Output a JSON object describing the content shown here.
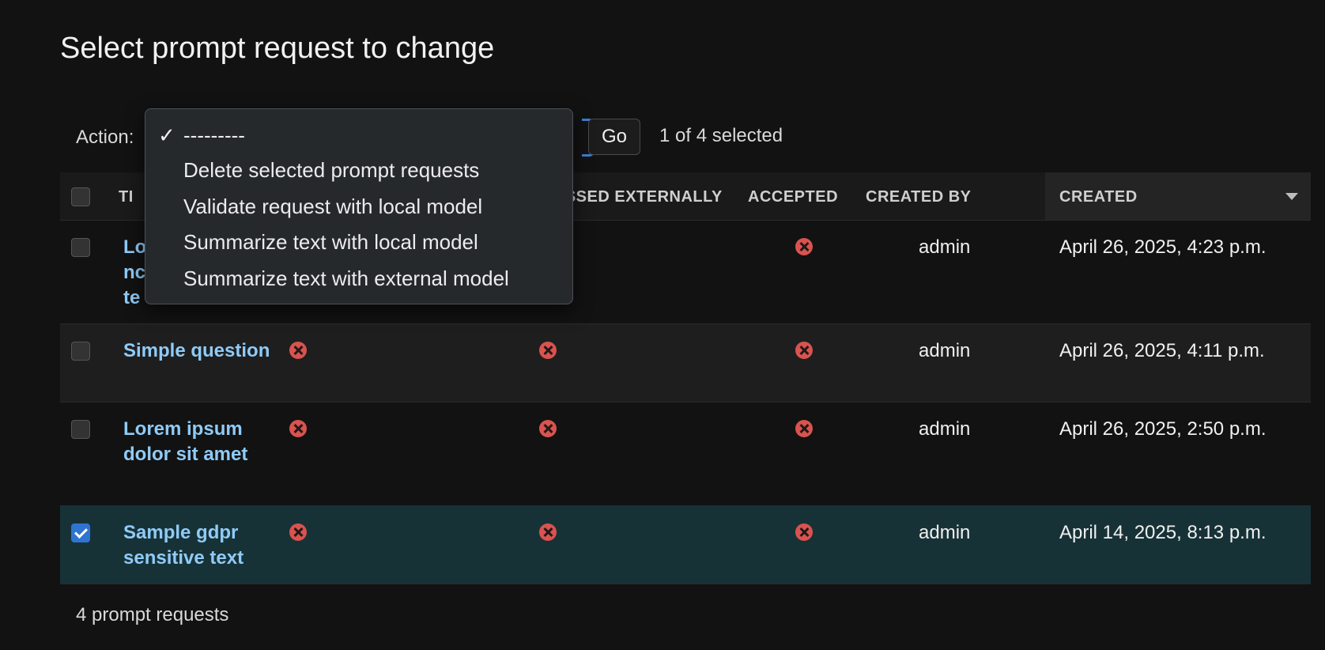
{
  "page": {
    "title": "Select prompt request to change"
  },
  "actions": {
    "label": "Action:",
    "options": [
      "---------",
      "Delete selected prompt requests",
      "Validate request with local model",
      "Summarize text with local model",
      "Summarize text with external model"
    ],
    "selected_index": 0,
    "go_label": "Go",
    "selection_status": "1 of 4 selected"
  },
  "table": {
    "headers": [
      "TI",
      "OCESSED EXTERNALLY",
      "ACCEPTED",
      "CREATED BY",
      "CREATED"
    ],
    "rows": [
      {
        "title_visible": [
          "Lo",
          "nc",
          "te"
        ],
        "processed": null,
        "processed_externally": null,
        "accepted": false,
        "created_by": "admin",
        "created": "April 26, 2025, 4:23 p.m.",
        "checked": false
      },
      {
        "title": "Simple question",
        "processed": false,
        "processed_externally": false,
        "accepted": false,
        "created_by": "admin",
        "created": "April 26, 2025, 4:11 p.m.",
        "checked": false
      },
      {
        "title": "Lorem ipsum dolor sit amet",
        "processed": false,
        "processed_externally": false,
        "accepted": false,
        "created_by": "admin",
        "created": "April 26, 2025, 2:50 p.m.",
        "checked": false
      },
      {
        "title": "Sample gdpr sensitive text",
        "processed": false,
        "processed_externally": false,
        "accepted": false,
        "created_by": "admin",
        "created": "April 14, 2025, 8:13 p.m.",
        "checked": true
      }
    ]
  },
  "footer": {
    "count": "4 prompt requests"
  },
  "icons": {
    "checkmark": "checkmark-icon",
    "false_value": "x-circle-icon",
    "sort": "sort-desc-icon"
  },
  "colors": {
    "link": "#8fcbf7",
    "selected_row": "#173237",
    "false_icon": "#d9534f",
    "accent": "#2f74d0"
  }
}
